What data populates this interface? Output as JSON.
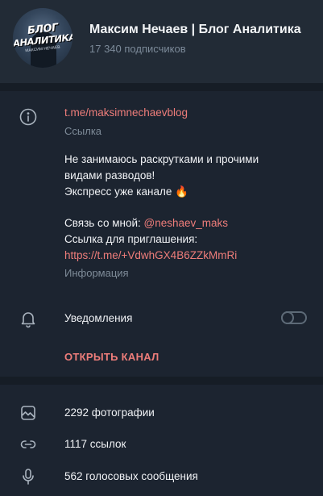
{
  "channel": {
    "avatar_text_line1": "БЛОГ",
    "avatar_text_line2": "АНАЛИТИКА",
    "avatar_text_line3": "МАКСИМ НЕЧАЕВ",
    "title": "Максим Нечаев | Блог Аналитика",
    "subscribers": "17 340 подписчиков"
  },
  "info": {
    "link": "t.me/maksimnechaevblog",
    "link_label": "Ссылка",
    "description_line1": "Не занимаюсь раскрутками и прочими",
    "description_line2": "видами разводов!",
    "description_line3": "Экспресс уже канале",
    "description_emoji": "🔥",
    "contact_prefix": "Связь со мной: ",
    "contact_handle": "@neshaev_maks",
    "invite_label": "Ссылка для приглашения:",
    "invite_link": "https://t.me/+VdwhGX4B6ZZkMmRi",
    "info_label": "Информация"
  },
  "notifications": {
    "label": "Уведомления",
    "enabled": false
  },
  "actions": {
    "open_channel": "ОТКРЫТЬ КАНАЛ"
  },
  "media": [
    {
      "icon": "photo-icon",
      "label": "2292 фотографии"
    },
    {
      "icon": "link-icon",
      "label": "1117 ссылок"
    },
    {
      "icon": "microphone-icon",
      "label": "562 голосовых сообщения"
    }
  ],
  "colors": {
    "accent": "#ee7d7a",
    "background": "#1c2430",
    "header": "#222b36",
    "secondary_text": "#7e8b98"
  }
}
